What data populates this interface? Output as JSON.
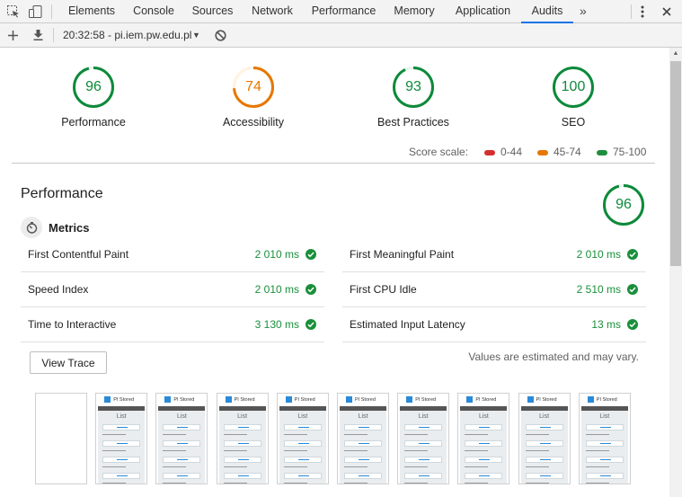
{
  "devtools": {
    "tabs": [
      "Elements",
      "Console",
      "Sources",
      "Network",
      "Performance",
      "Memory",
      "Application",
      "Audits"
    ],
    "active_tab": "Audits",
    "more_tabs_label": "»"
  },
  "toolbar": {
    "report_label": "20:32:58 - pi.iem.pw.edu.pl",
    "dropdown_arrow": "▼"
  },
  "gauges": [
    {
      "score": "96",
      "label": "Performance",
      "color": "#0d8a3a"
    },
    {
      "score": "74",
      "label": "Accessibility",
      "color": "#e67700"
    },
    {
      "score": "93",
      "label": "Best Practices",
      "color": "#0d8a3a"
    },
    {
      "score": "100",
      "label": "SEO",
      "color": "#0d8a3a"
    }
  ],
  "score_scale": {
    "label": "Score scale:",
    "ranges": [
      {
        "label": "0-44",
        "color": "#d32f2f"
      },
      {
        "label": "45-74",
        "color": "#e67700"
      },
      {
        "label": "75-100",
        "color": "#1e8e3e"
      }
    ]
  },
  "performance": {
    "title": "Performance",
    "score": "96",
    "metrics_label": "Metrics",
    "metrics": [
      {
        "name": "First Contentful Paint",
        "value": "2 010 ms"
      },
      {
        "name": "First Meaningful Paint",
        "value": "2 010 ms"
      },
      {
        "name": "Speed Index",
        "value": "2 010 ms"
      },
      {
        "name": "First CPU Idle",
        "value": "2 510 ms"
      },
      {
        "name": "Time to Interactive",
        "value": "3 130 ms"
      },
      {
        "name": "Estimated Input Latency",
        "value": "13 ms"
      }
    ],
    "view_trace_label": "View Trace",
    "estimate_note": "Values are estimated and may vary."
  },
  "filmstrip": {
    "frame_count": 10,
    "site_name": "PI Stored",
    "page_heading": "List"
  },
  "colors": {
    "pass": "#1a8f3b",
    "accent": "#1a73e8"
  }
}
